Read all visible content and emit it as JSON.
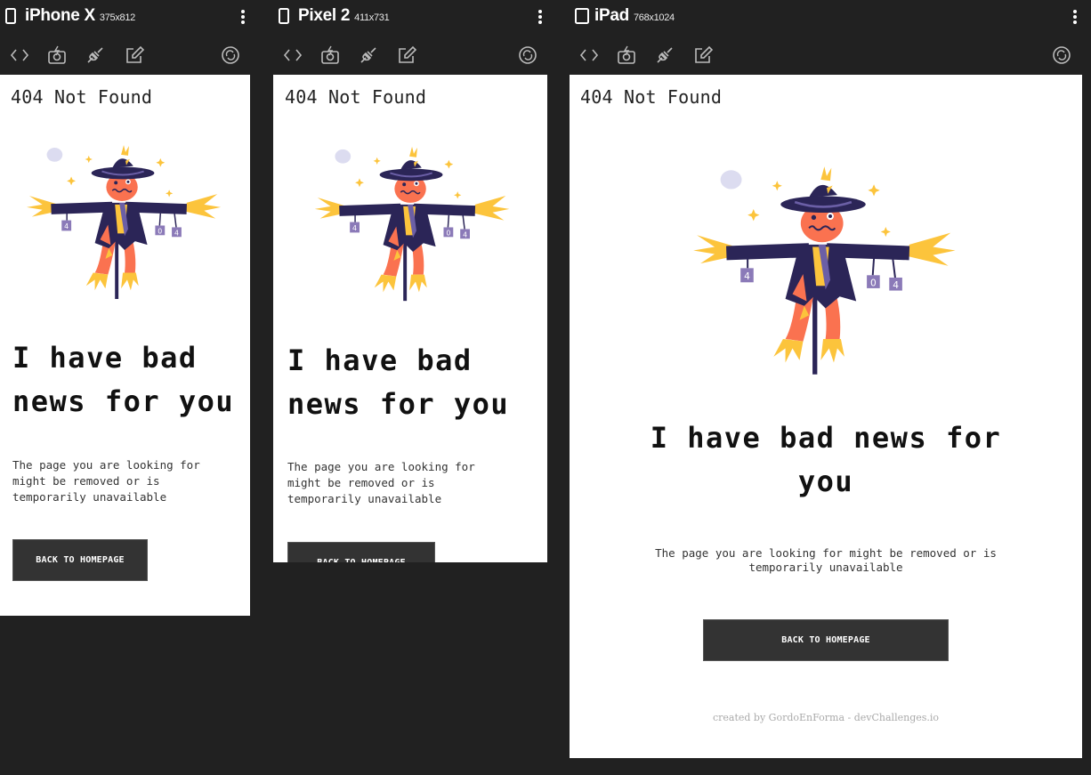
{
  "devices": [
    {
      "name": "iPhone X",
      "size": "375x812"
    },
    {
      "name": "Pixel 2",
      "size": "411x731"
    },
    {
      "name": "iPad",
      "size": "768x1024"
    }
  ],
  "toolbar_icons": [
    "code-icon",
    "camera-icon",
    "plug-icon",
    "edit-icon",
    "rotate-icon"
  ],
  "page": {
    "title": "404 Not Found",
    "heading": "I have bad news for you",
    "message": "The page you are looking for might be removed or is temporarily unavailable",
    "button": "BACK TO HOMEPAGE",
    "footer": "created by GordoEnForma - devChallenges.io",
    "sign_digits": [
      "4",
      "0",
      "4"
    ]
  },
  "colors": {
    "background": "#212121",
    "screen": "#ffffff",
    "button": "#333333",
    "scarecrow_purple": "#2b2557",
    "scarecrow_orange": "#fa7250",
    "straw_yellow": "#fcc43c"
  }
}
